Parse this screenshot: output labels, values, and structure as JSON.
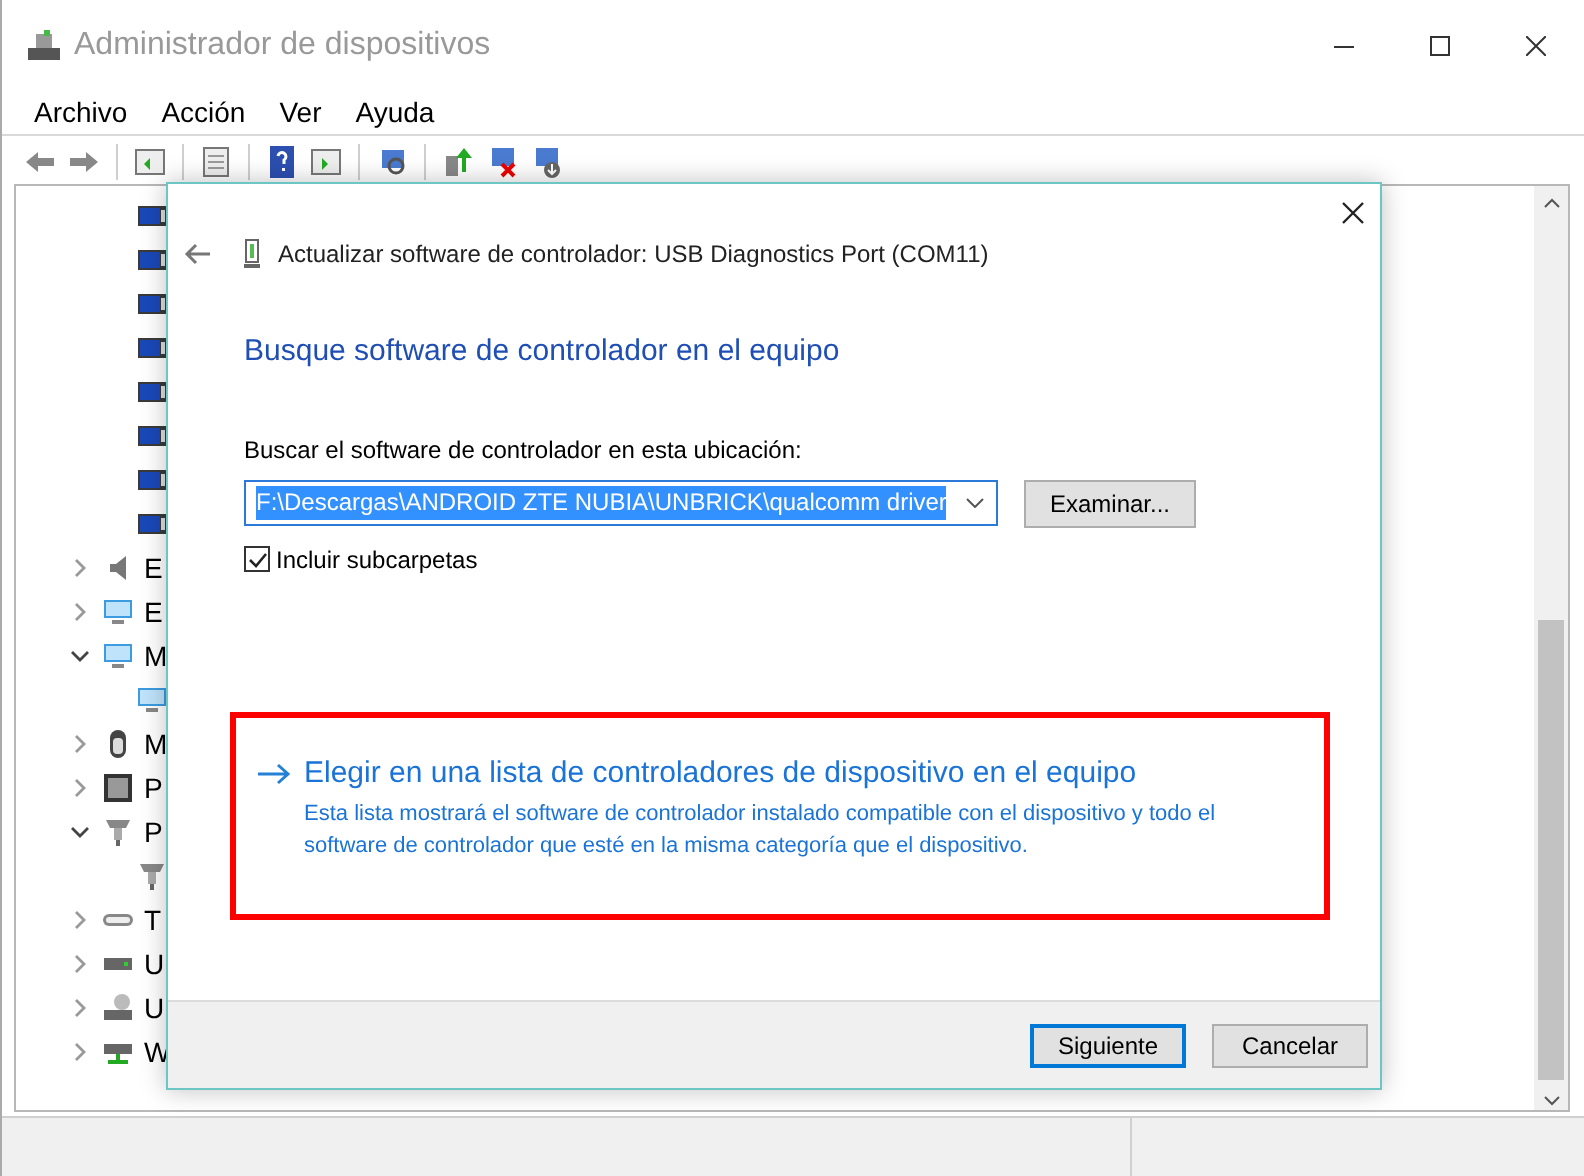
{
  "window": {
    "title": "Administrador de dispositivos"
  },
  "menu": [
    {
      "label": "Archivo"
    },
    {
      "label": "Acción"
    },
    {
      "label": "Ver"
    },
    {
      "label": "Ayuda"
    }
  ],
  "tree": {
    "visible_children": [
      {
        "kind": "port"
      },
      {
        "kind": "port"
      },
      {
        "kind": "port"
      },
      {
        "kind": "port"
      },
      {
        "kind": "port"
      },
      {
        "kind": "port"
      },
      {
        "kind": "port"
      },
      {
        "kind": "port"
      }
    ],
    "items": [
      {
        "label": "E",
        "kind": "speaker",
        "expanded": false
      },
      {
        "label": "E",
        "kind": "monitor",
        "expanded": false
      },
      {
        "label": "M",
        "kind": "monitor",
        "expanded": true,
        "children": [
          {
            "kind": "monitor"
          }
        ]
      },
      {
        "label": "M",
        "kind": "mouse",
        "expanded": false
      },
      {
        "label": "P",
        "kind": "chip",
        "expanded": false
      },
      {
        "label": "P",
        "kind": "usb",
        "expanded": true,
        "children": [
          {
            "kind": "usb"
          }
        ]
      },
      {
        "label": "T",
        "kind": "keyboard",
        "expanded": false
      },
      {
        "label": "U",
        "kind": "drive",
        "expanded": false
      },
      {
        "label": "U",
        "kind": "disc",
        "expanded": false
      },
      {
        "label": "W",
        "kind": "network",
        "expanded": false
      }
    ]
  },
  "dialog": {
    "header": "Actualizar software de controlador: USB Diagnostics Port (COM11)",
    "heading": "Busque software de controlador en el equipo",
    "location_label": "Buscar el software de controlador en esta ubicación:",
    "path": "F:\\Descargas\\ANDROID ZTE NUBIA\\UNBRICK\\qualcomm driver",
    "browse_button": "Examinar...",
    "include_subfolders": {
      "label": "Incluir subcarpetas",
      "checked": true
    },
    "option": {
      "title": "Elegir en una lista de controladores de dispositivo en el equipo",
      "description": "Esta lista mostrará el software de controlador instalado compatible con el dispositivo y todo el software de controlador que esté en la misma categoría que el dispositivo."
    },
    "buttons": [
      {
        "label": "Siguiente",
        "default": true
      },
      {
        "label": "Cancelar",
        "default": false
      }
    ]
  }
}
